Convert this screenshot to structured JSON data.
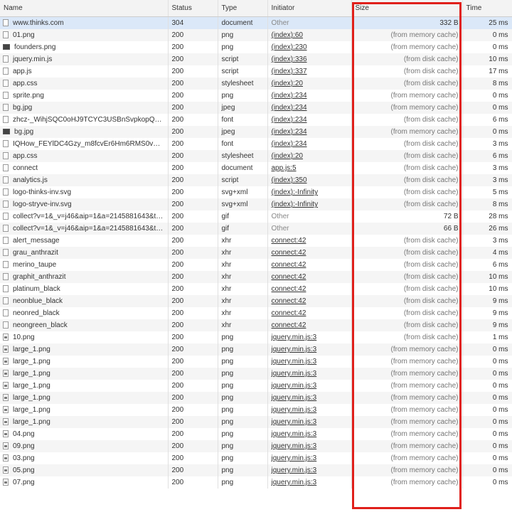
{
  "headers": {
    "name": "Name",
    "status": "Status",
    "type": "Type",
    "initiator": "Initiator",
    "size": "Size",
    "time": "Time"
  },
  "colors": {
    "highlight": "#e0201b",
    "selected_row": "#dbe8f8"
  },
  "rows": [
    {
      "name": "www.thinks.com",
      "icon": "document-icon",
      "status": "304",
      "type": "document",
      "initiator": "Other",
      "size": "332 B",
      "time": "25 ms"
    },
    {
      "name": "01.png",
      "icon": "file-icon",
      "status": "200",
      "type": "png",
      "initiator": "(index):60",
      "size": "(from memory cache)",
      "time": "0 ms"
    },
    {
      "name": "founders.png",
      "icon": "image-thumbnail-icon",
      "status": "200",
      "type": "png",
      "initiator": "(index):230",
      "size": "(from memory cache)",
      "time": "0 ms"
    },
    {
      "name": "jquery.min.js",
      "icon": "file-icon",
      "status": "200",
      "type": "script",
      "initiator": "(index):336",
      "size": "(from disk cache)",
      "time": "10 ms"
    },
    {
      "name": "app.js",
      "icon": "file-icon",
      "status": "200",
      "type": "script",
      "initiator": "(index):337",
      "size": "(from disk cache)",
      "time": "17 ms"
    },
    {
      "name": "app.css",
      "icon": "file-icon",
      "status": "200",
      "type": "stylesheet",
      "initiator": "(index):20",
      "size": "(from disk cache)",
      "time": "8 ms"
    },
    {
      "name": "sprite.png",
      "icon": "file-icon",
      "status": "200",
      "type": "png",
      "initiator": "(index):234",
      "size": "(from memory cache)",
      "time": "0 ms"
    },
    {
      "name": "bg.jpg",
      "icon": "file-icon",
      "status": "200",
      "type": "jpeg",
      "initiator": "(index):234",
      "size": "(from memory cache)",
      "time": "0 ms"
    },
    {
      "name": "zhcz-_WihjSQC0oHJ9TCYC3USBnSvpkopQaUR-...",
      "icon": "file-icon",
      "status": "200",
      "type": "font",
      "initiator": "(index):234",
      "size": "(from disk cache)",
      "time": "6 ms"
    },
    {
      "name": "bg.jpg",
      "icon": "image-thumbnail-icon",
      "status": "200",
      "type": "jpeg",
      "initiator": "(index):234",
      "size": "(from memory cache)",
      "time": "0 ms"
    },
    {
      "name": "IQHow_FEYlDC4Gzy_m8fcvEr6Hm6RMS0v1dtXs...",
      "icon": "file-icon",
      "status": "200",
      "type": "font",
      "initiator": "(index):234",
      "size": "(from disk cache)",
      "time": "3 ms"
    },
    {
      "name": "app.css",
      "icon": "file-icon",
      "status": "200",
      "type": "stylesheet",
      "initiator": "(index):20",
      "size": "(from disk cache)",
      "time": "6 ms"
    },
    {
      "name": "connect",
      "icon": "file-icon",
      "status": "200",
      "type": "document",
      "initiator": "app.js:5",
      "size": "(from disk cache)",
      "time": "3 ms"
    },
    {
      "name": "analytics.js",
      "icon": "file-icon",
      "status": "200",
      "type": "script",
      "initiator": "(index):350",
      "size": "(from disk cache)",
      "time": "3 ms"
    },
    {
      "name": "logo-thinks-inv.svg",
      "icon": "file-icon",
      "status": "200",
      "type": "svg+xml",
      "initiator": "(index):-Infinity",
      "size": "(from disk cache)",
      "time": "5 ms"
    },
    {
      "name": "logo-stryve-inv.svg",
      "icon": "file-icon",
      "status": "200",
      "type": "svg+xml",
      "initiator": "(index):-Infinity",
      "size": "(from disk cache)",
      "time": "8 ms"
    },
    {
      "name": "collect?v=1&_v=j46&aip=1&a=2145881643&t=pa...",
      "icon": "file-icon",
      "status": "200",
      "type": "gif",
      "initiator": "Other",
      "size": "72 B",
      "time": "28 ms"
    },
    {
      "name": "collect?v=1&_v=j46&aip=1&a=2145881643&t=ti...",
      "icon": "file-icon",
      "status": "200",
      "type": "gif",
      "initiator": "Other",
      "size": "66 B",
      "time": "26 ms"
    },
    {
      "name": "alert_message",
      "icon": "file-icon",
      "status": "200",
      "type": "xhr",
      "initiator": "connect:42",
      "size": "(from disk cache)",
      "time": "3 ms"
    },
    {
      "name": "grau_anthrazit",
      "icon": "file-icon",
      "status": "200",
      "type": "xhr",
      "initiator": "connect:42",
      "size": "(from disk cache)",
      "time": "4 ms"
    },
    {
      "name": "merino_taupe",
      "icon": "file-icon",
      "status": "200",
      "type": "xhr",
      "initiator": "connect:42",
      "size": "(from disk cache)",
      "time": "6 ms"
    },
    {
      "name": "graphit_anthrazit",
      "icon": "file-icon",
      "status": "200",
      "type": "xhr",
      "initiator": "connect:42",
      "size": "(from disk cache)",
      "time": "10 ms"
    },
    {
      "name": "platinum_black",
      "icon": "file-icon",
      "status": "200",
      "type": "xhr",
      "initiator": "connect:42",
      "size": "(from disk cache)",
      "time": "10 ms"
    },
    {
      "name": "neonblue_black",
      "icon": "file-icon",
      "status": "200",
      "type": "xhr",
      "initiator": "connect:42",
      "size": "(from disk cache)",
      "time": "9 ms"
    },
    {
      "name": "neonred_black",
      "icon": "file-icon",
      "status": "200",
      "type": "xhr",
      "initiator": "connect:42",
      "size": "(from disk cache)",
      "time": "9 ms"
    },
    {
      "name": "neongreen_black",
      "icon": "file-icon",
      "status": "200",
      "type": "xhr",
      "initiator": "connect:42",
      "size": "(from disk cache)",
      "time": "9 ms"
    },
    {
      "name": "10.png",
      "icon": "image-file-icon",
      "status": "200",
      "type": "png",
      "initiator": "jquery.min.js:3",
      "size": "(from disk cache)",
      "time": "1 ms"
    },
    {
      "name": "large_1.png",
      "icon": "image-file-icon",
      "status": "200",
      "type": "png",
      "initiator": "jquery.min.js:3",
      "size": "(from memory cache)",
      "time": "0 ms"
    },
    {
      "name": "large_1.png",
      "icon": "image-file-icon",
      "status": "200",
      "type": "png",
      "initiator": "jquery.min.js:3",
      "size": "(from memory cache)",
      "time": "0 ms"
    },
    {
      "name": "large_1.png",
      "icon": "image-file-icon",
      "status": "200",
      "type": "png",
      "initiator": "jquery.min.js:3",
      "size": "(from memory cache)",
      "time": "0 ms"
    },
    {
      "name": "large_1.png",
      "icon": "image-file-icon",
      "status": "200",
      "type": "png",
      "initiator": "jquery.min.js:3",
      "size": "(from memory cache)",
      "time": "0 ms"
    },
    {
      "name": "large_1.png",
      "icon": "image-file-icon",
      "status": "200",
      "type": "png",
      "initiator": "jquery.min.js:3",
      "size": "(from memory cache)",
      "time": "0 ms"
    },
    {
      "name": "large_1.png",
      "icon": "image-file-icon",
      "status": "200",
      "type": "png",
      "initiator": "jquery.min.js:3",
      "size": "(from memory cache)",
      "time": "0 ms"
    },
    {
      "name": "large_1.png",
      "icon": "image-file-icon",
      "status": "200",
      "type": "png",
      "initiator": "jquery.min.js:3",
      "size": "(from memory cache)",
      "time": "0 ms"
    },
    {
      "name": "04.png",
      "icon": "image-file-icon",
      "status": "200",
      "type": "png",
      "initiator": "jquery.min.js:3",
      "size": "(from memory cache)",
      "time": "0 ms"
    },
    {
      "name": "09.png",
      "icon": "image-file-icon",
      "status": "200",
      "type": "png",
      "initiator": "jquery.min.js:3",
      "size": "(from memory cache)",
      "time": "0 ms"
    },
    {
      "name": "03.png",
      "icon": "image-file-icon",
      "status": "200",
      "type": "png",
      "initiator": "jquery.min.js:3",
      "size": "(from memory cache)",
      "time": "0 ms"
    },
    {
      "name": "05.png",
      "icon": "image-file-icon",
      "status": "200",
      "type": "png",
      "initiator": "jquery.min.js:3",
      "size": "(from memory cache)",
      "time": "0 ms"
    },
    {
      "name": "07.png",
      "icon": "image-file-icon",
      "status": "200",
      "type": "png",
      "initiator": "jquery.min.js:3",
      "size": "(from memory cache)",
      "time": "0 ms"
    }
  ]
}
